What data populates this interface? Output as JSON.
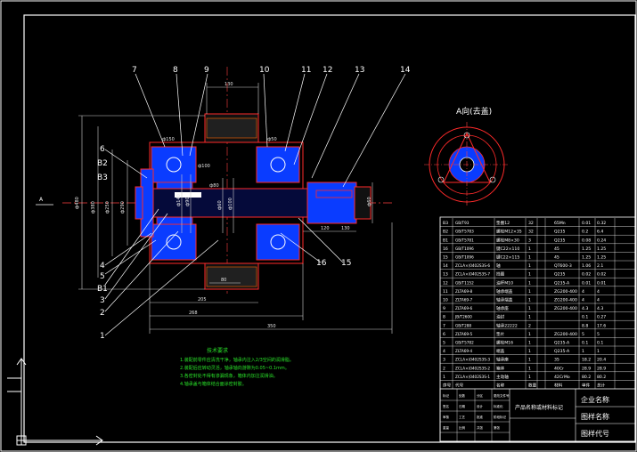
{
  "drawing": {
    "view_label": "A向(去盖)",
    "section_label": "A",
    "callouts": [
      "7",
      "8",
      "9",
      "10",
      "11",
      "12",
      "13",
      "14",
      "6",
      "B2",
      "B3",
      "4",
      "5",
      "B1",
      "3",
      "2",
      "1",
      "16",
      "15"
    ],
    "dimensions": [
      "130",
      "ф480",
      "ф380",
      "ф250",
      "ф290",
      "ф140",
      "ф90",
      "ф60",
      "ф100",
      "ф60",
      "120",
      "130",
      "80",
      "205",
      "268",
      "350",
      "ф100",
      "ф80",
      "ф50",
      "ф150"
    ],
    "notes_title": "技术要求",
    "notes": [
      "1.装配前零件应清洗干净，轴承内注入2/3空间的润滑脂。",
      "2.装配后应转动灵活，轴承轴向游隙为0.05~0.1mm。",
      "3.各密封处不得有渗漏现象，箱体内加注润滑油。",
      "4.轴承盖与箱体结合面涂密封胶。"
    ]
  },
  "bom": {
    "rows": [
      [
        "B3",
        "GB/T93",
        "垫圈12",
        "32",
        "",
        "65Mn",
        "0.01",
        "0.32"
      ],
      [
        "B2",
        "GB/T5783",
        "螺栓M12×35",
        "32",
        "",
        "Q235",
        "0.2",
        "6.4"
      ],
      [
        "B1",
        "GB/T5781",
        "螺栓M8×30",
        "3",
        "",
        "Q235",
        "0.08",
        "0.24"
      ],
      [
        "16",
        "GB/T1096",
        "键C22×110",
        "1",
        "",
        "45",
        "1.25",
        "1.25"
      ],
      [
        "15",
        "GB/T1096",
        "键C22×115",
        "1",
        "",
        "45",
        "1.25",
        "1.25"
      ],
      [
        "14",
        "ZCLA×(0402S3S-6",
        "轴",
        "1",
        "",
        "QT600-3",
        "1.06",
        "2.1"
      ],
      [
        "13",
        "ZCLA×(0402S3S-7",
        "挡圈",
        "1",
        "",
        "Q235",
        "0.02",
        "0.02"
      ],
      [
        "12",
        "GB/T1152",
        "油杯M10",
        "1",
        "",
        "Q235-A",
        "0.01",
        "0.01"
      ],
      [
        "11",
        "ZLTA69-8",
        "轴承端盖",
        "1",
        "",
        "ZG200-400",
        "4",
        "4"
      ],
      [
        "10",
        "ZLTA69-7",
        "轴承端盖",
        "1",
        "",
        "ZG200-400",
        "4",
        "4"
      ],
      [
        "9",
        "ZLTA69-6",
        "轴承座",
        "1",
        "",
        "ZG200-400",
        "4.3",
        "4.3"
      ],
      [
        "8",
        "JB/T2600",
        "油封",
        "1",
        "",
        "",
        "0.1",
        "0.27"
      ],
      [
        "7",
        "GB/T288",
        "轴承22222",
        "2",
        "",
        "",
        "8.8",
        "17.6"
      ],
      [
        "6",
        "ZLTA69-5",
        "垫片",
        "1",
        "",
        "ZG200-400",
        "5",
        "5"
      ],
      [
        "5",
        "GB/T5782",
        "螺栓M16",
        "1",
        "",
        "Q235-A",
        "0.1",
        "0.1"
      ],
      [
        "4",
        "ZLTA69-4",
        "端盖",
        "1",
        "",
        "Q235-A",
        "1",
        "1"
      ],
      [
        "3",
        "ZCLA×(0402S3S-3",
        "轴承座",
        "1",
        "",
        "35",
        "18.2",
        "20.4"
      ],
      [
        "2",
        "ZCLA×(0402S3S-2",
        "箱体",
        "1",
        "",
        "40Cr",
        "28.9",
        "28.9"
      ],
      [
        "1",
        "ZCLA×(0402S3S-1",
        "主动轴",
        "1",
        "",
        "42CrMo",
        "80.2",
        "80.2"
      ]
    ],
    "header": [
      "序号",
      "代号",
      "名称",
      "数量",
      "",
      "材料",
      "单件",
      "总计"
    ],
    "title_block": {
      "main_title": "产品名称或材料标记",
      "company": "企业名称",
      "drawing_name": "图样名称",
      "drawing_code": "图样代号",
      "small_labels": [
        "标记",
        "处数",
        "分区",
        "更改文件号",
        "签名",
        "日期",
        "设计",
        "标准化",
        "审核",
        "工艺",
        "批准",
        "阶段标记",
        "重量",
        "比例",
        "共张",
        "第张"
      ]
    }
  },
  "colors": {
    "background": "#000000",
    "border": "#ffffff",
    "part_outline": "#ff2a2a",
    "part_fill": "#0a3cff",
    "dimension": "#e6e6e6",
    "callout": "#ffffff",
    "centerline": "#ff4040",
    "note_text": "#29e329",
    "table_text": "#ffffff",
    "hatch": "#ff6600"
  },
  "ui": {
    "ucs_icon": "ucs-axis-icon",
    "grid_icon": "viewport-grid-icon"
  }
}
